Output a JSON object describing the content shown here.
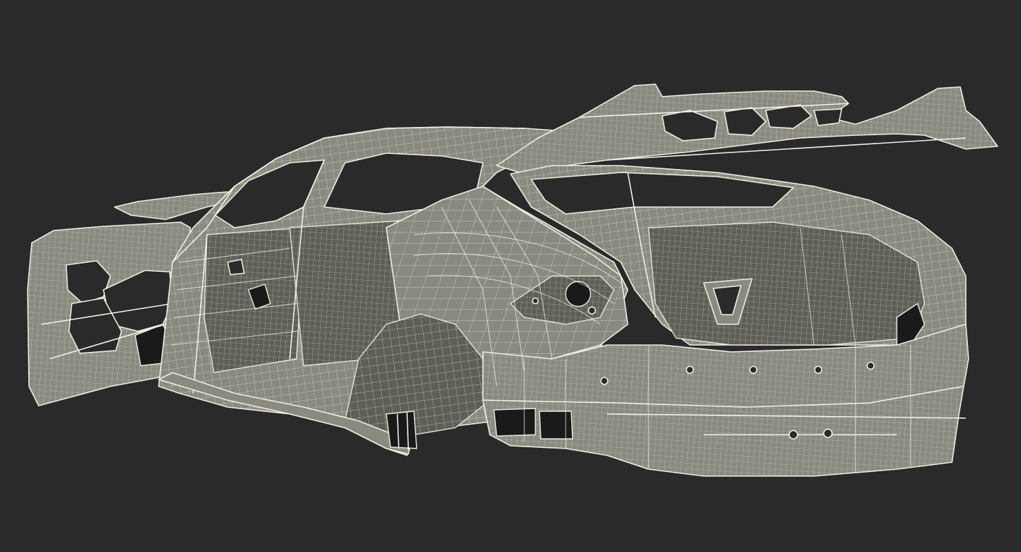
{
  "scene": {
    "background_color": "#2a2a2a",
    "mesh_fill_color": "#8a8a80",
    "mesh_shadow_color": "#5f5f58",
    "wire_color": "#f2f0e4",
    "subject_icon": "car-body-wireframe-icon"
  }
}
